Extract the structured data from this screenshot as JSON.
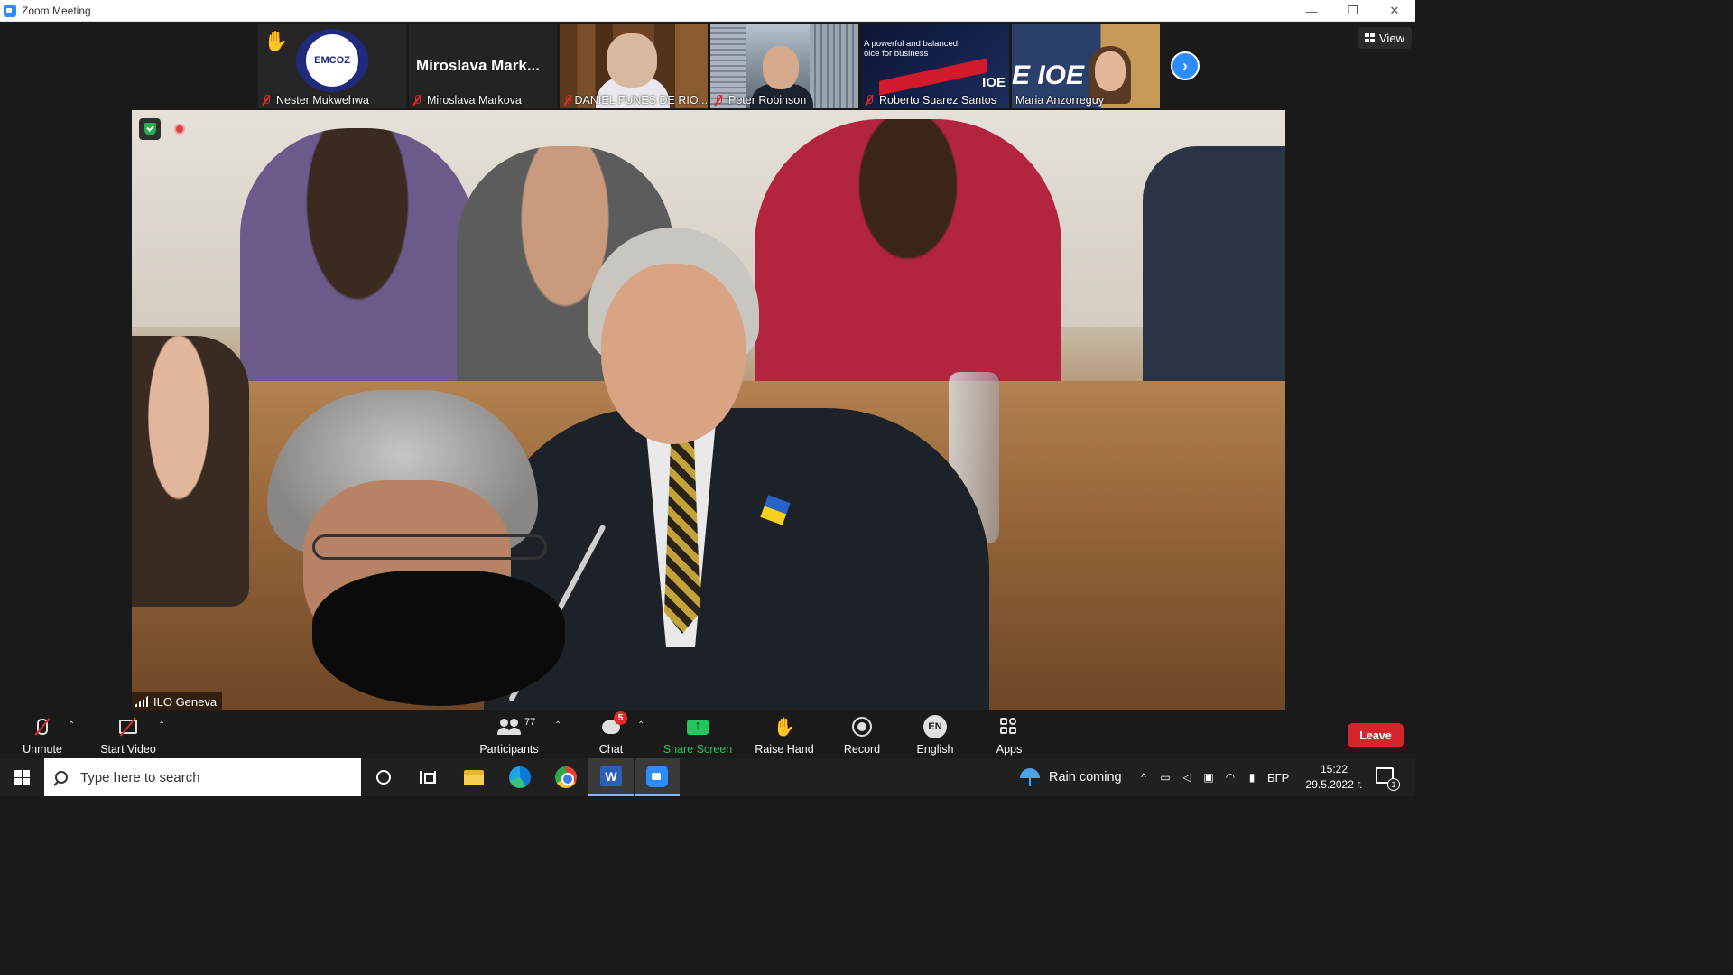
{
  "window": {
    "title": "Zoom Meeting",
    "controls": {
      "minimize": "—",
      "restore": "❐",
      "close": "✕"
    }
  },
  "thumbnails": [
    {
      "name": "Nester Mukwehwa",
      "type": "logo",
      "logo_text": "EMCOZ",
      "hand_raised": true,
      "muted": true
    },
    {
      "name": "Miroslava Markova",
      "type": "text",
      "display_name": "Miroslava  Mark...",
      "muted": true
    },
    {
      "name": "DANIEL FUNES DE RIO...",
      "type": "video",
      "muted": true
    },
    {
      "name": "Peter Robinson",
      "type": "video",
      "muted": true
    },
    {
      "name": "Roberto Suarez Santos",
      "type": "video",
      "slogan": "A powerful and balanced oice for business",
      "mark": "IOE",
      "muted": true
    },
    {
      "name": "Maria Anzorreguy",
      "type": "video",
      "mark": "E IOE",
      "muted": false
    }
  ],
  "next_page_label": "›",
  "view_button": {
    "label": "View"
  },
  "main_video": {
    "label": "ILO Geneva"
  },
  "toolbar": {
    "unmute_label": "Unmute",
    "start_video_label": "Start Video",
    "participants_label": "Participants",
    "participants_count": "77",
    "chat_label": "Chat",
    "chat_badge": "5",
    "share_label": "Share Screen",
    "raise_hand_label": "Raise Hand",
    "record_label": "Record",
    "language_label": "English",
    "language_code": "EN",
    "apps_label": "Apps",
    "leave_label": "Leave",
    "caret": "⌃"
  },
  "taskbar": {
    "search_placeholder": "Type here to search",
    "word_letter": "W",
    "weather_text": "Rain coming",
    "tray_lang": "БГР",
    "time": "15:22",
    "date": "29.5.2022 г.",
    "notification_count": "1"
  },
  "colors": {
    "zoom_blue": "#2d8cff",
    "leave_red": "#d7252d",
    "share_green": "#23c55e",
    "muted_red": "#e02828"
  }
}
